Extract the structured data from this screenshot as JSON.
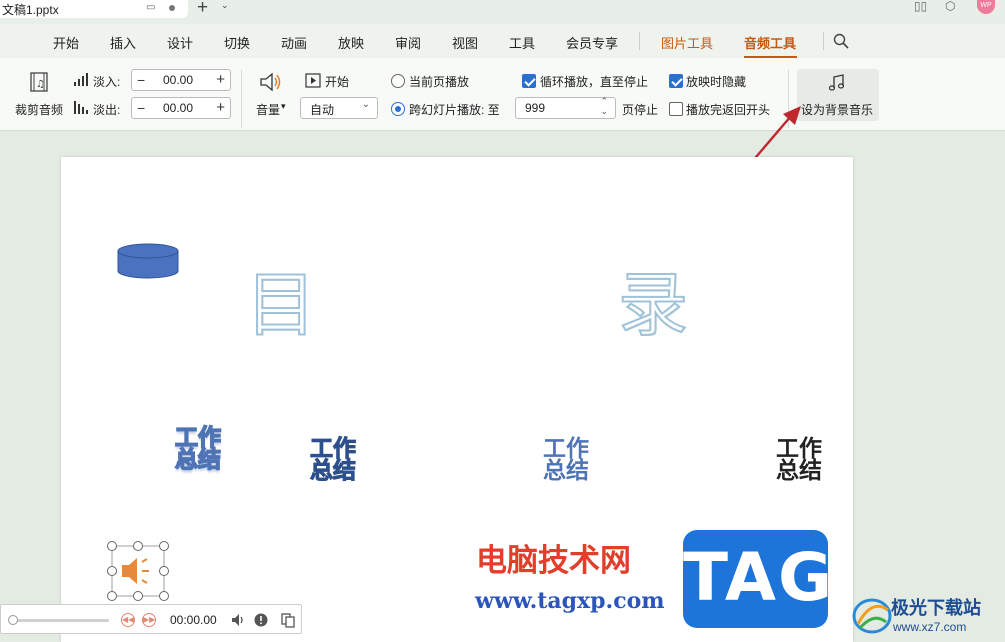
{
  "titlebar": {
    "doc_name": "文稿1.pptx",
    "new_tab_label": "+"
  },
  "menu": {
    "items": [
      "开始",
      "插入",
      "设计",
      "切换",
      "动画",
      "放映",
      "审阅",
      "视图",
      "工具",
      "会员专享",
      "图片工具",
      "音频工具"
    ],
    "active": "音频工具"
  },
  "ribbon": {
    "trim_audio": "裁剪音频",
    "fade_in_label": "淡入:",
    "fade_in_value": "00.00",
    "fade_out_label": "淡出:",
    "fade_out_value": "00.00",
    "volume_label": "音量",
    "start_label": "开始",
    "start_select": "自动",
    "play_current_page": "当前页播放",
    "play_across_slides": "跨幻灯片播放: 至",
    "across_slides_value": "999",
    "page_stop": "页停止",
    "loop_play": "循环播放，直至停止",
    "loop_checked": true,
    "hide_during_show": "放映时隐藏",
    "hide_checked": true,
    "rewind_after_play": "播放完返回开头",
    "rewind_checked": false,
    "set_bg_music": "设为背景音乐"
  },
  "slide": {
    "title_left": "目",
    "title_right": "录",
    "wordart_line1": "工作",
    "wordart_line2": "总结"
  },
  "player": {
    "time": "00:00.00"
  },
  "watermark": {
    "site_cn": "电脑技术网",
    "site_url": "www.tagxp.com",
    "tag": "TAG",
    "brand_cn": "极光下载站",
    "brand_url": "www.xz7.com"
  },
  "colors": {
    "accent_orange": "#c55a11",
    "check_blue": "#2b6fd1",
    "tag_blue": "#1d74d9",
    "wordart_blue": "#4f74b5"
  }
}
